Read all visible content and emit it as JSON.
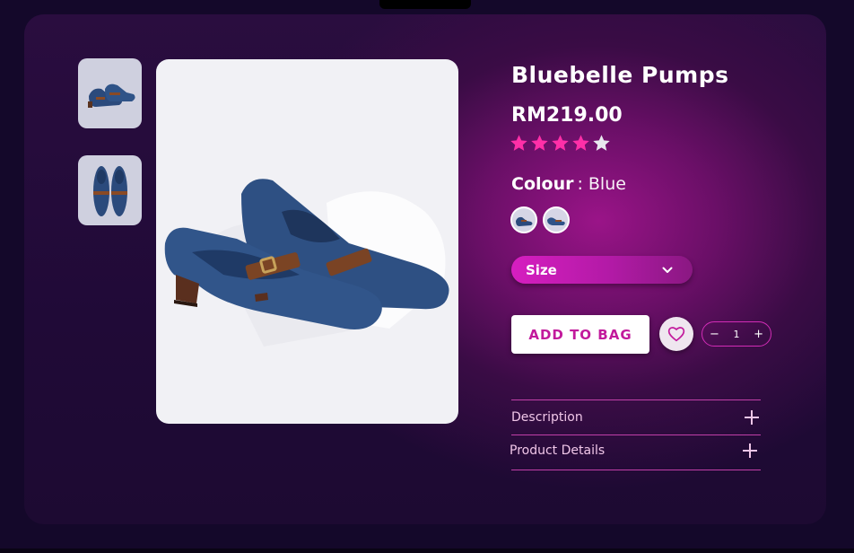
{
  "product": {
    "title": "Bluebelle Pumps",
    "price": "RM219.00",
    "rating": 4,
    "rating_max": 5,
    "colour_label": "Colour",
    "colour_separator": ":",
    "colour_value": "Blue"
  },
  "size_select": {
    "label": "Size"
  },
  "actions": {
    "add_to_bag": "ADD TO BAG",
    "quantity": "1",
    "decrement": "−",
    "increment": "+"
  },
  "accordion": [
    {
      "label": "Description"
    },
    {
      "label": "Product Details"
    }
  ],
  "colors": {
    "accent": "#c21a9c",
    "star_filled": "#ff2fa8",
    "star_empty": "#e8e8ee",
    "card_glow": "#9a1488"
  },
  "icons": {
    "wishlist": "heart-icon",
    "size_dropdown": "chevron-down-icon",
    "accordion_expand": "plus-icon"
  }
}
